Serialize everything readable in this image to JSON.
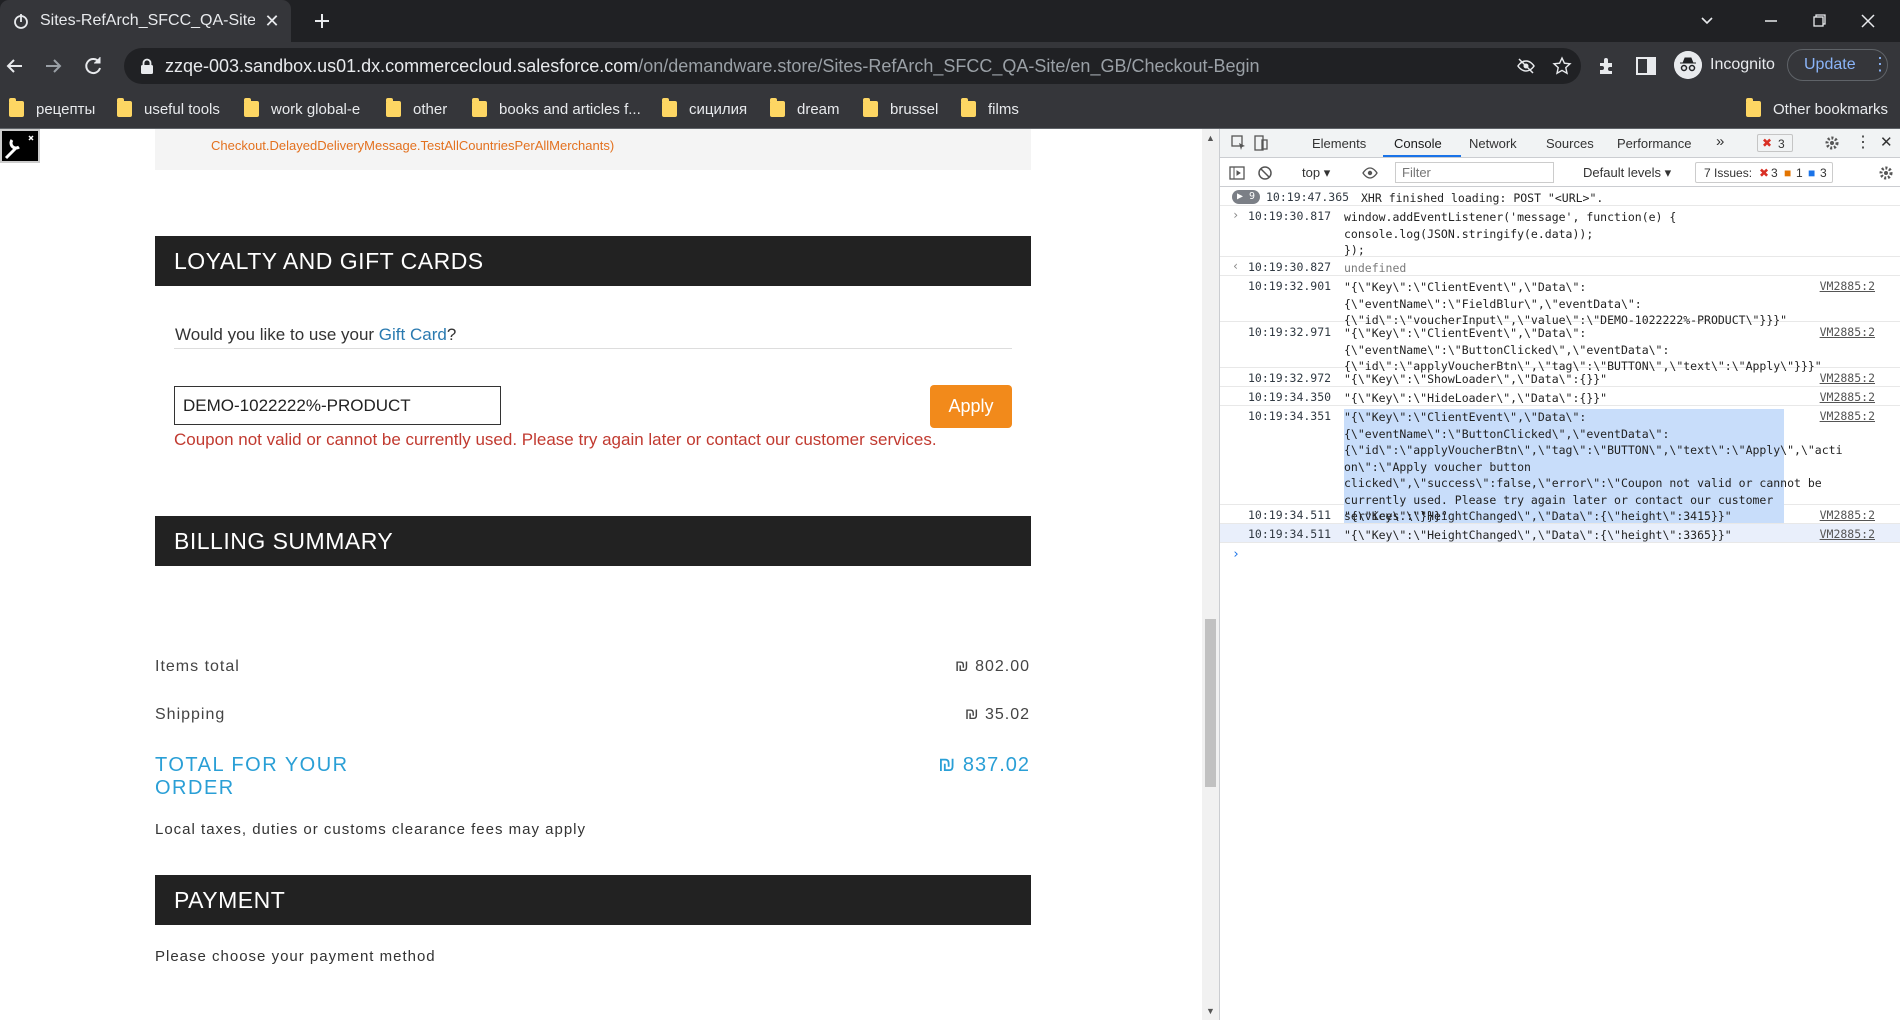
{
  "browser": {
    "tab_title": "Sites-RefArch_SFCC_QA-Site | Sal",
    "url_host": "zzqe-003.sandbox.us01.dx.commercecloud.salesforce.com",
    "url_path": "/on/demandware.store/Sites-RefArch_SFCC_QA-Site/en_GB/Checkout-Begin",
    "profile_label": "Incognito",
    "update_label": "Update",
    "bookmarks": [
      "рецепты",
      "useful tools",
      "work global-e",
      "other",
      "books and articles f...",
      "сицилия",
      "dream",
      "brussel",
      "films"
    ],
    "other_bookmarks": "Other bookmarks"
  },
  "page": {
    "delayed_msg": "Checkout.DelayedDeliveryMessage.TestAllCountriesPerAllMerchants)",
    "loyalty_heading": "LOYALTY AND GIFT CARDS",
    "gift_question_pre": "Would you like to use your ",
    "gift_link": "Gift Card",
    "gift_question_post": "?",
    "voucher_value": "DEMO-1022222%-PRODUCT",
    "apply_label": "Apply",
    "voucher_error": "Coupon not valid or cannot be currently used. Please try again later or contact our customer services.",
    "billing_heading": "BILLING SUMMARY",
    "items_total_label": "Items total",
    "items_total_value": "₪ 802.00",
    "shipping_label": "Shipping",
    "shipping_value": "₪ 35.02",
    "total_label": "TOTAL FOR YOUR ORDER",
    "total_value": "₪ 837.02",
    "taxes_note": "Local taxes, duties or customs clearance fees may apply",
    "payment_heading": "PAYMENT",
    "payment_prompt": "Please choose your payment method"
  },
  "devtools": {
    "tabs": [
      "Elements",
      "Console",
      "Network",
      "Sources",
      "Performance"
    ],
    "active_tab": "Console",
    "error_count": "3",
    "context": "top",
    "filter_placeholder": "Filter",
    "levels": "Default levels",
    "issues_label": "7 Issues:",
    "issues_errors": "3",
    "issues_warnings": "1",
    "issues_info": "3",
    "xhr_group_count": "9",
    "console_rows": [
      {
        "ts": "10:19:47.365",
        "msg": "XHR finished loading: POST \"<URL>\".",
        "src": ""
      },
      {
        "ts": "10:19:30.817",
        "msg": "window.addEventListener('message', function(e) {\nconsole.log(JSON.stringify(e.data));\n});",
        "src": ""
      },
      {
        "ts": "10:19:30.827",
        "msg": "undefined",
        "src": ""
      },
      {
        "ts": "10:19:32.901",
        "msg": "\"{\\\"Key\\\":\\\"ClientEvent\\\",\\\"Data\\\":\n{\\\"eventName\\\":\\\"FieldBlur\\\",\\\"eventData\\\":\n{\\\"id\\\":\\\"voucherInput\\\",\\\"value\\\":\\\"DEMO-1022222%-PRODUCT\\\"}}}\"",
        "src": "VM2885:2"
      },
      {
        "ts": "10:19:32.971",
        "msg": "\"{\\\"Key\\\":\\\"ClientEvent\\\",\\\"Data\\\":\n{\\\"eventName\\\":\\\"ButtonClicked\\\",\\\"eventData\\\":\n{\\\"id\\\":\\\"applyVoucherBtn\\\",\\\"tag\\\":\\\"BUTTON\\\",\\\"text\\\":\\\"Apply\\\"}}}\"",
        "src": "VM2885:2"
      },
      {
        "ts": "10:19:32.972",
        "msg": "\"{\\\"Key\\\":\\\"ShowLoader\\\",\\\"Data\\\":{}}\"",
        "src": "VM2885:2"
      },
      {
        "ts": "10:19:34.350",
        "msg": "\"{\\\"Key\\\":\\\"HideLoader\\\",\\\"Data\\\":{}}\"",
        "src": "VM2885:2"
      },
      {
        "ts": "10:19:34.351",
        "msg": "\"{\\\"Key\\\":\\\"ClientEvent\\\",\\\"Data\\\":\n{\\\"eventName\\\":\\\"ButtonClicked\\\",\\\"eventData\\\":\n{\\\"id\\\":\\\"applyVoucherBtn\\\",\\\"tag\\\":\\\"BUTTON\\\",\\\"text\\\":\\\"Apply\\\",\\\"acti\non\\\":\\\"Apply voucher button\nclicked\\\",\\\"success\\\":false,\\\"error\\\":\\\"Coupon not valid or cannot be\ncurrently used. Please try again later or contact our customer\nservices.\\\"}}}\"",
        "src": "VM2885:2"
      },
      {
        "ts": "10:19:34.511",
        "msg": "\"{\\\"Key\\\":\\\"HeightChanged\\\",\\\"Data\\\":{\\\"height\\\":3415}}\"",
        "src": "VM2885:2"
      },
      {
        "ts": "10:19:34.511",
        "msg": "\"{\\\"Key\\\":\\\"HeightChanged\\\",\\\"Data\\\":{\\\"height\\\":3365}}\"",
        "src": "VM2885:2"
      }
    ]
  },
  "colors": {
    "accent_orange": "#f28a1b",
    "total_blue": "#2a9fd6",
    "error_red": "#c13a30",
    "section_dark": "#222222"
  }
}
